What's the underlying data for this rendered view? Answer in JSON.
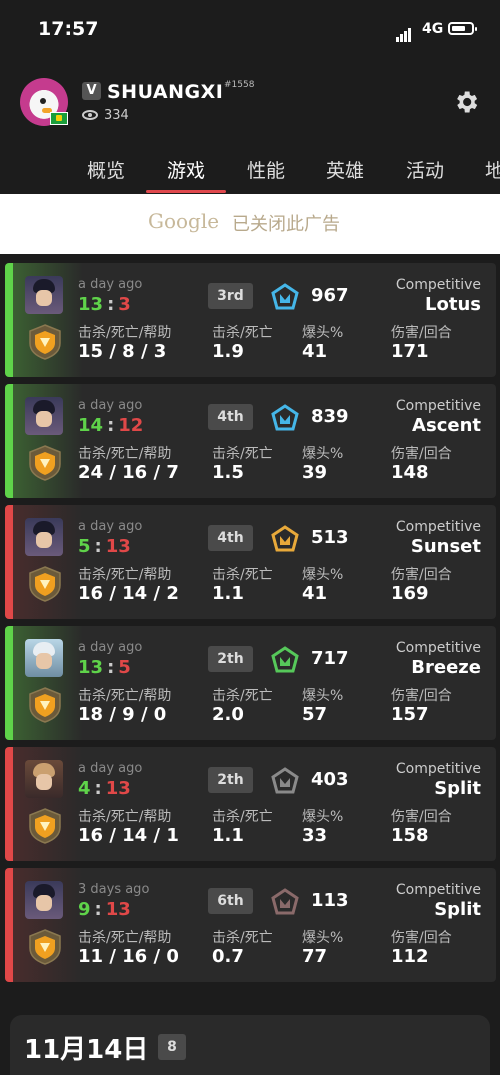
{
  "status": {
    "time": "17:57",
    "network": "4G"
  },
  "profile": {
    "username": "SHUANGXI",
    "tag": "#1558",
    "views": "334"
  },
  "tabs": [
    "概览",
    "游戏",
    "性能",
    "英雄",
    "活动",
    "地"
  ],
  "active_tab": 1,
  "ad": {
    "brand": "Google",
    "text": "已关闭此广告"
  },
  "labels": {
    "kda": "击杀/死亡/帮助",
    "kd": "击杀/死亡",
    "hs": "爆头%",
    "dmg": "伤害/回合"
  },
  "matches": [
    {
      "result": "win",
      "ago": "a day ago",
      "score_a": "13",
      "score_b": "3",
      "place": "3rd",
      "rr": "967",
      "mode": "Competitive",
      "map": "Lotus",
      "kda": "15 / 8 / 3",
      "kd": "1.9",
      "hs": "41",
      "dmg": "171",
      "rank_color": "#45b6e8"
    },
    {
      "result": "win",
      "ago": "a day ago",
      "score_a": "14",
      "score_b": "12",
      "place": "4th",
      "rr": "839",
      "mode": "Competitive",
      "map": "Ascent",
      "kda": "24 / 16 / 7",
      "kd": "1.5",
      "hs": "39",
      "dmg": "148",
      "rank_color": "#45b6e8"
    },
    {
      "result": "loss",
      "ago": "a day ago",
      "score_a": "5",
      "score_b": "13",
      "place": "4th",
      "rr": "513",
      "mode": "Competitive",
      "map": "Sunset",
      "kda": "16 / 14 / 2",
      "kd": "1.1",
      "hs": "41",
      "dmg": "169",
      "rank_color": "#e8a93a"
    },
    {
      "result": "win",
      "ago": "a day ago",
      "score_a": "13",
      "score_b": "5",
      "place": "2th",
      "rr": "717",
      "mode": "Competitive",
      "map": "Breeze",
      "kda": "18 / 9 / 0",
      "kd": "2.0",
      "hs": "57",
      "dmg": "157",
      "rank_color": "#56c85a"
    },
    {
      "result": "loss",
      "ago": "a day ago",
      "score_a": "4",
      "score_b": "13",
      "place": "2th",
      "rr": "403",
      "mode": "Competitive",
      "map": "Split",
      "kda": "16 / 14 / 1",
      "kd": "1.1",
      "hs": "33",
      "dmg": "158",
      "rank_color": "#8a8a8a"
    },
    {
      "result": "loss",
      "ago": "3 days ago",
      "score_a": "9",
      "score_b": "13",
      "place": "6th",
      "rr": "113",
      "mode": "Competitive",
      "map": "Split",
      "kda": "11 / 16 / 0",
      "kd": "0.7",
      "hs": "77",
      "dmg": "112",
      "rank_color": "#8a6a6a"
    }
  ],
  "day_header": {
    "date": "11月14日",
    "count": "8"
  }
}
